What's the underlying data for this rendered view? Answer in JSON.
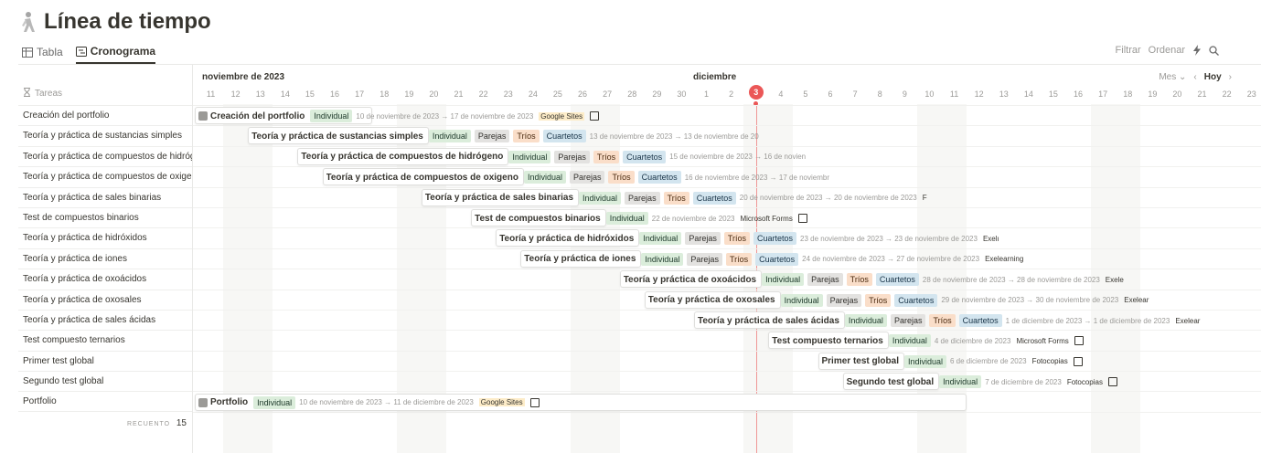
{
  "page": {
    "title": "Línea de tiempo",
    "icon": "person-walking-icon"
  },
  "views": {
    "table_label": "Tabla",
    "timeline_label": "Cronograma",
    "active": "Cronograma"
  },
  "toolbar": {
    "filter_label": "Filtrar",
    "sort_label": "Ordenar"
  },
  "timeline_controls": {
    "scale_label": "Mes",
    "today_label": "Hoy"
  },
  "left_header": "Tareas",
  "count": {
    "label": "RECUENTO",
    "value": "15"
  },
  "months": [
    {
      "label": "noviembre de 2023"
    },
    {
      "label": "diciembre"
    }
  ],
  "days": [
    "11",
    "12",
    "13",
    "14",
    "15",
    "16",
    "17",
    "18",
    "19",
    "20",
    "21",
    "22",
    "23",
    "24",
    "25",
    "26",
    "27",
    "28",
    "29",
    "30",
    "1",
    "2",
    "3",
    "4",
    "5",
    "6",
    "7",
    "8",
    "9",
    "10",
    "11",
    "12",
    "13",
    "14",
    "15",
    "16",
    "17",
    "18",
    "19",
    "20",
    "21",
    "22",
    "23"
  ],
  "today_day": "3",
  "tasks": [
    {
      "name": "Creación del portfolio",
      "tags": [
        "Individual"
      ],
      "date": "10 de noviembre de 2023 → 17 de noviembre de 2023",
      "tool": "Google Sites",
      "checkbox": true
    },
    {
      "name": "Teoría y práctica de sustancias simples",
      "tags": [
        "Individual",
        "Parejas",
        "Tríos",
        "Cuartetos"
      ],
      "date": "13 de noviembre de 2023 → 13 de noviembre de 20",
      "tool": "",
      "checkbox": false
    },
    {
      "name": "Teoría y práctica de compuestos de hidrógeno",
      "tags": [
        "Individual",
        "Parejas",
        "Tríos",
        "Cuartetos"
      ],
      "date": "15 de noviembre de 2023 → 16 de novien",
      "tool": "",
      "checkbox": false
    },
    {
      "name": "Teoría y práctica de compuestos de oxigeno",
      "tags": [
        "Individual",
        "Parejas",
        "Tríos",
        "Cuartetos"
      ],
      "date": "16 de noviembre de 2023 → 17 de noviembr",
      "tool": "",
      "checkbox": false
    },
    {
      "name": "Teoría y práctica de sales binarias",
      "tags": [
        "Individual",
        "Parejas",
        "Tríos",
        "Cuartetos"
      ],
      "date": "20 de noviembre de 2023 → 20 de noviembre de 2023",
      "tool": "F",
      "checkbox": false
    },
    {
      "name": "Test de compuestos binarios",
      "tags": [
        "Individual"
      ],
      "date": "22 de noviembre de 2023",
      "tool": "Microsoft Forms",
      "checkbox": true
    },
    {
      "name": "Teoría y práctica de hidróxidos",
      "tags": [
        "Individual",
        "Parejas",
        "Tríos",
        "Cuartetos"
      ],
      "date": "23 de noviembre de 2023 → 23 de noviembre de 2023",
      "tool": "Exelı",
      "checkbox": false
    },
    {
      "name": "Teoría y práctica de iones",
      "tags": [
        "Individual",
        "Parejas",
        "Tríos",
        "Cuartetos"
      ],
      "date": "24 de noviembre de 2023 → 27 de noviembre de 2023",
      "tool": "Exelearning",
      "checkbox": false
    },
    {
      "name": "Teoría y práctica de oxoácidos",
      "tags": [
        "Individual",
        "Parejas",
        "Tríos",
        "Cuartetos"
      ],
      "date": "28 de noviembre de 2023 → 28 de noviembre de 2023",
      "tool": "Exele",
      "checkbox": false
    },
    {
      "name": "Teoría y práctica de oxosales",
      "tags": [
        "Individual",
        "Parejas",
        "Tríos",
        "Cuartetos"
      ],
      "date": "29 de noviembre de 2023 → 30 de noviembre de 2023",
      "tool": "Exelear",
      "checkbox": false
    },
    {
      "name": "Teoría y práctica de sales ácidas",
      "tags": [
        "Individual",
        "Parejas",
        "Tríos",
        "Cuartetos"
      ],
      "date": "1 de diciembre de 2023 → 1 de diciembre de 2023",
      "tool": "Exelear",
      "checkbox": false
    },
    {
      "name": "Test compuesto ternarios",
      "tags": [
        "Individual"
      ],
      "date": "4 de diciembre de 2023",
      "tool": "Microsoft Forms",
      "checkbox": true
    },
    {
      "name": "Primer test global",
      "tags": [
        "Individual"
      ],
      "date": "6 de diciembre de 2023",
      "tool": "Fotocopias",
      "checkbox": true
    },
    {
      "name": "Segundo test global",
      "tags": [
        "Individual"
      ],
      "date": "7 de diciembre de 2023",
      "tool": "Fotocopias",
      "checkbox": true
    },
    {
      "name": "Portfolio",
      "tags": [
        "Individual"
      ],
      "date": "10 de noviembre de 2023 → 11 de diciembre de 2023",
      "tool": "Google Sites",
      "checkbox": true
    }
  ],
  "left_rows": [
    "Creación del portfolio",
    "Teoría y práctica de sustancias simples",
    "Teoría y práctica de compuestos de hidrógе",
    "Teoría y práctica de compuestos de oxigenе",
    "Teoría y práctica de sales binarias",
    "Test de compuestos binarios",
    "Teoría y práctica de hidróxidos",
    "Teoría y práctica de iones",
    "Teoría y práctica de oxoácidos",
    "Teoría y práctica de oxosales",
    "Teoría y práctica de sales ácidas",
    "Test compuesto ternarios",
    "Primer test global",
    "Segundo test global",
    "Portfolio"
  ],
  "colors": {
    "today": "#eb5757",
    "individual": "#dbeddb",
    "parejas": "#e3e2e0",
    "trios": "#fadec9",
    "cuartetos": "#d3e5ef"
  }
}
